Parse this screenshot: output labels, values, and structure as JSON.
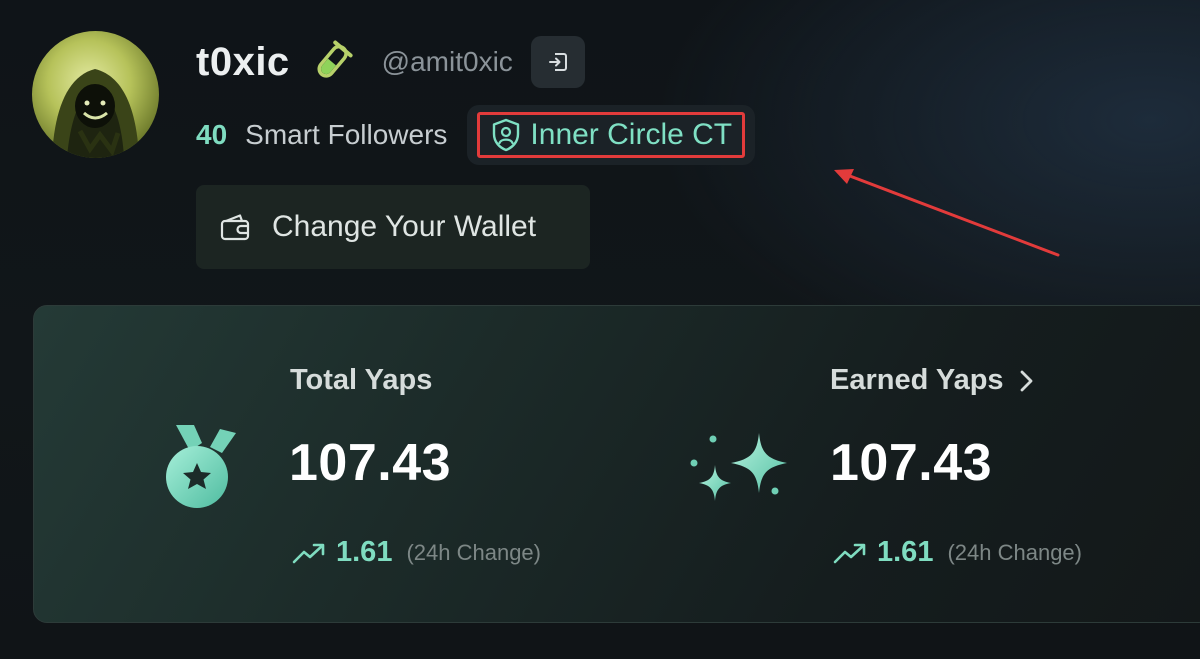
{
  "profile": {
    "display_name": "t0xic",
    "handle": "@amit0xic",
    "verified_icon": "test-tube-icon",
    "logout_icon": "sign-in-icon"
  },
  "followers": {
    "count": "40",
    "label": "Smart Followers"
  },
  "badge": {
    "icon": "shield-user-icon",
    "label": "Inner Circle CT",
    "highlight_color": "#e23b3b"
  },
  "wallet": {
    "icon": "wallet-icon",
    "label": "Change Your Wallet"
  },
  "stats": {
    "total": {
      "icon": "medal-icon",
      "title": "Total Yaps",
      "value": "107.43",
      "change": "1.61",
      "change_label": "(24h Change)"
    },
    "earned": {
      "icon": "sparkles-icon",
      "title": "Earned Yaps",
      "title_icon": "chevron-right-icon",
      "value": "107.43",
      "change": "1.61",
      "change_label": "(24h Change)"
    }
  },
  "colors": {
    "accent": "#7fdcc0",
    "background": "#111619",
    "card": "#1c2b29"
  }
}
